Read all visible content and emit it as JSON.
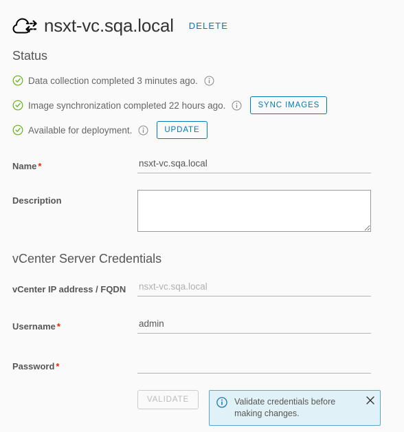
{
  "header": {
    "icon": "cloud-sync-icon",
    "title": "nsxt-vc.sqa.local",
    "delete_label": "DELETE"
  },
  "status": {
    "heading": "Status",
    "rows": [
      {
        "icon": "success-check-icon",
        "text": "Data collection completed 3 minutes ago.",
        "info_icon": "info-icon",
        "button": null
      },
      {
        "icon": "success-check-icon",
        "text": "Image synchronization completed 22 hours ago.",
        "info_icon": "info-icon",
        "button": "SYNC IMAGES"
      },
      {
        "icon": "success-check-icon",
        "text": "Available for deployment.",
        "info_icon": "info-icon",
        "button": "UPDATE"
      }
    ]
  },
  "form": {
    "name": {
      "label": "Name",
      "required": "*",
      "value": "nsxt-vc.sqa.local",
      "placeholder": ""
    },
    "description": {
      "label": "Description",
      "value": "",
      "placeholder": ""
    }
  },
  "credentials": {
    "heading": "vCenter Server Credentials",
    "fqdn": {
      "label": "vCenter IP address / FQDN",
      "value": "",
      "placeholder": "nsxt-vc.sqa.local"
    },
    "username": {
      "label": "Username",
      "required": "*",
      "value": "admin",
      "placeholder": ""
    },
    "password": {
      "label": "Password",
      "required": "*",
      "value": "",
      "placeholder": ""
    }
  },
  "actions": {
    "validate_label": "VALIDATE",
    "alert": {
      "icon": "info-circle-icon",
      "text": "Validate credentials before making changes.",
      "close_icon": "close-icon"
    }
  },
  "colors": {
    "accent_blue": "#0079b8",
    "success_green": "#60b515",
    "required_red": "#e62700",
    "alert_bg": "#e1f1f8",
    "alert_border": "#5aa3d0",
    "page_bg": "#fafafa",
    "text": "#565656"
  }
}
